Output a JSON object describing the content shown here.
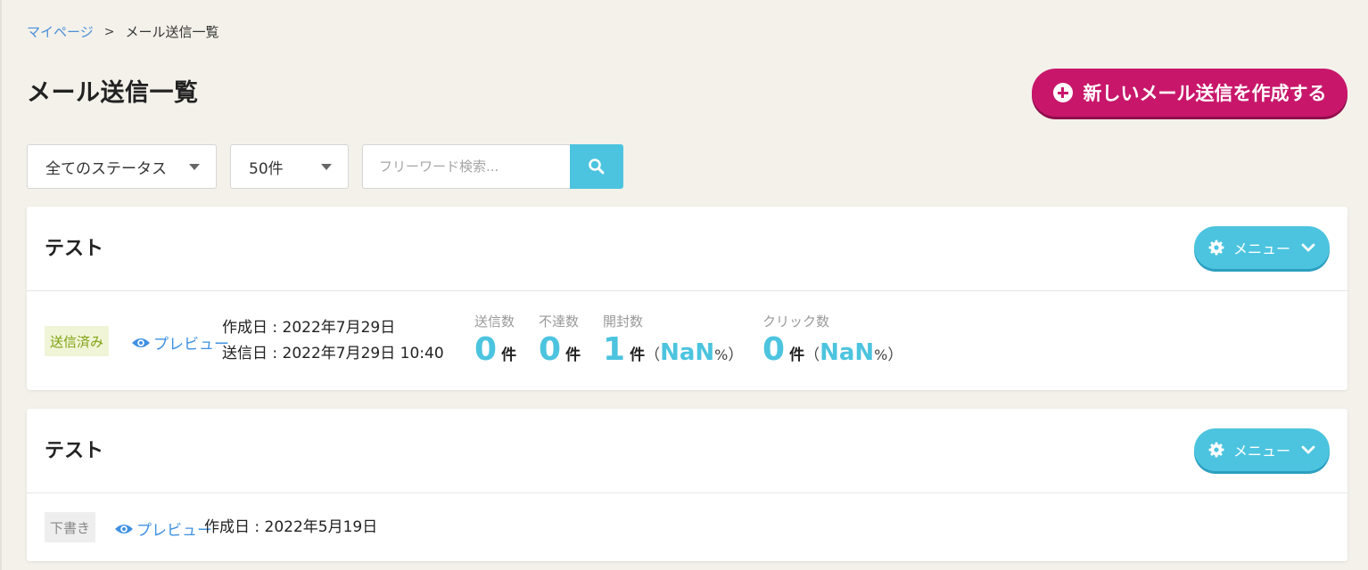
{
  "breadcrumb": {
    "home": "マイページ",
    "separator": ">",
    "current": "メール送信一覧"
  },
  "page_title": "メール送信一覧",
  "create_button": {
    "label": "新しいメール送信を作成する",
    "icon": "plus-circle-icon"
  },
  "filters": {
    "status": "全てのステータス",
    "count": "50件",
    "search_placeholder": "フリーワード検索...",
    "search_icon": "search-icon"
  },
  "mails": [
    {
      "title": "テスト",
      "menu_label": "メニュー",
      "status": "送信済み",
      "preview_label": "プレビュー",
      "created": "作成日 : 2022年7月29日",
      "sent": "送信日 : 2022年7月29日  10:40",
      "stats": {
        "sent": {
          "label": "送信数",
          "value": "0",
          "unit": "件"
        },
        "bounce": {
          "label": "不達数",
          "value": "0",
          "unit": "件"
        },
        "open": {
          "label": "開封数",
          "value": "1",
          "unit": "件",
          "paren_open": "（",
          "rate": "NaN",
          "percent": "%",
          "paren_close": "）"
        },
        "click": {
          "label": "クリック数",
          "value": "0",
          "unit": "件",
          "paren_open": "（",
          "rate": "NaN",
          "percent": "%",
          "paren_close": "）"
        }
      }
    },
    {
      "title": "テスト",
      "menu_label": "メニュー",
      "status": "下書き",
      "preview_label": "プレビュー",
      "created": "作成日 : 2022年5月19日"
    }
  ],
  "colors": {
    "background": "#f3f1ea",
    "accent": "#4cc4df",
    "primary": "#c8176b",
    "link": "#3f91e2"
  }
}
